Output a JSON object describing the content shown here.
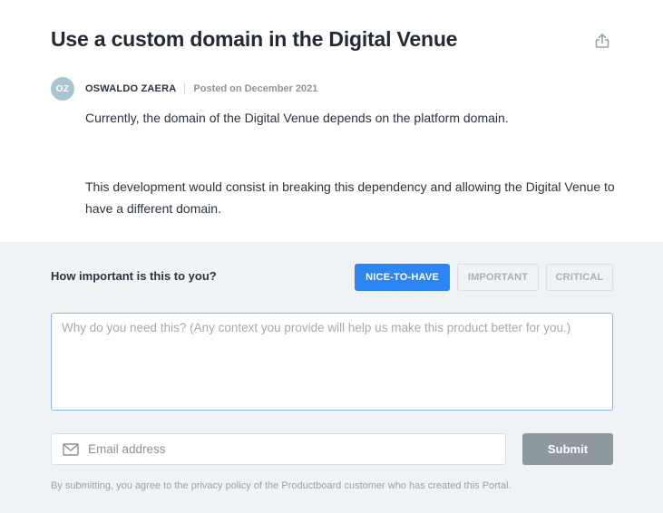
{
  "post": {
    "title": "Use a custom domain in the Digital Venue",
    "author_initials": "OZ",
    "author_name": "OSWALDO ZAERA",
    "posted": "Posted on December 2021",
    "paragraphs": [
      "Currently, the domain of the Digital Venue depends on the platform domain.",
      "This development would consist in breaking this dependency and allowing the Digital Venue to have a different domain."
    ]
  },
  "feedback": {
    "question": "How important is this to you?",
    "importance_options": [
      "NICE-TO-HAVE",
      "IMPORTANT",
      "CRITICAL"
    ],
    "selected_importance": "NICE-TO-HAVE",
    "context_placeholder": "Why do you need this? (Any context you provide will help us make this product better for you.)",
    "context_value": "",
    "email_placeholder": "Email address",
    "email_value": "",
    "submit_label": "Submit",
    "disclaimer": "By submitting, you agree to the privacy policy of the Productboard customer who has created this Portal."
  },
  "icons": {
    "share": "share-icon",
    "mail": "mail-icon"
  },
  "colors": {
    "accent": "#2b85f5",
    "avatar": "#a8c6d2",
    "submit": "#8d999f",
    "panel_bg": "#f0f3f6"
  }
}
